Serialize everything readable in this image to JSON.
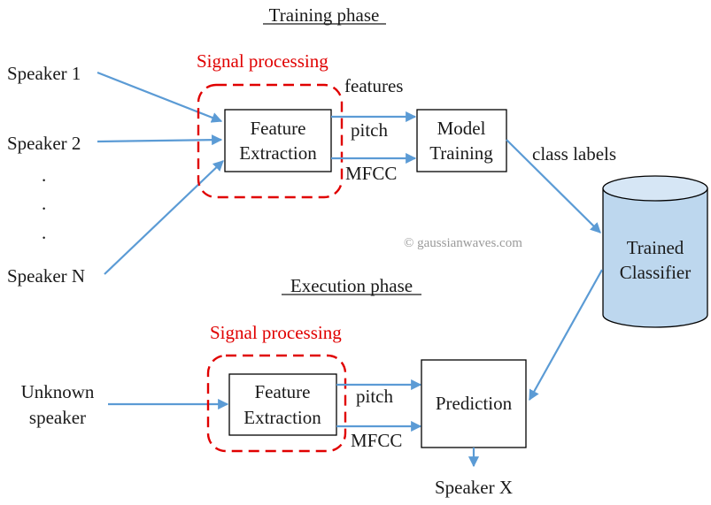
{
  "training_phase": {
    "title": "Training phase",
    "speakers": [
      "Speaker 1",
      "Speaker 2",
      "Speaker N"
    ],
    "ellipsis": [
      ".",
      ".",
      "."
    ],
    "signal_processing_label": "Signal processing",
    "feature_extraction": [
      "Feature",
      "Extraction"
    ],
    "features_label": "features",
    "pitch_label": "pitch",
    "mfcc_label": "MFCC",
    "model_training": [
      "Model",
      "Training"
    ],
    "class_labels": "class labels"
  },
  "classifier": {
    "label": [
      "Trained",
      "Classifier"
    ]
  },
  "watermark": "© gaussianwaves.com",
  "execution_phase": {
    "title": "Execution phase",
    "input": [
      "Unknown",
      "speaker"
    ],
    "signal_processing_label": "Signal processing",
    "feature_extraction": [
      "Feature",
      "Extraction"
    ],
    "pitch_label": "pitch",
    "mfcc_label": "MFCC",
    "prediction": "Prediction",
    "output": "Speaker X"
  },
  "colors": {
    "arrow": "#5b9bd5",
    "signal_box": "#e00000",
    "classifier_fill": "#bdd7ee"
  }
}
